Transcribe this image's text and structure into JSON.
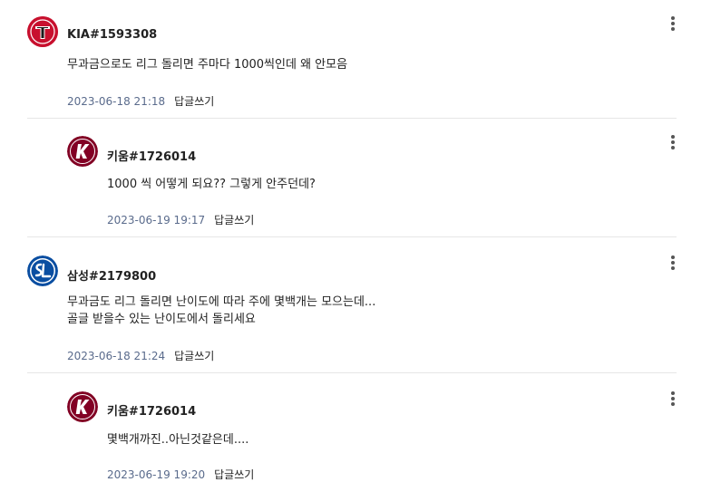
{
  "comments": [
    {
      "author": "KIA#1593308",
      "text": "무과금으로도 리그 돌리면 주마다 1000씩인데 왜 안모음",
      "date": "2023-06-18 21:18",
      "reply_label": "답글쓰기",
      "team": "KIA",
      "logo_glyph": "T",
      "logo_color": "#c8102e"
    },
    {
      "author": "키움#1726014",
      "text": "1000 씩 어떻게 되요?? 그렇게 안주던데?",
      "date": "2023-06-19 19:17",
      "reply_label": "답글쓰기",
      "team": "키움",
      "logo_glyph": "K",
      "logo_color": "#820024"
    },
    {
      "author": "삼성#2179800",
      "text": "무과금도 리그 돌리면 난이도에 따라 주에 몇백개는 모으는데...\n골글 받을수 있는 난이도에서 돌리세요",
      "date": "2023-06-18 21:24",
      "reply_label": "답글쓰기",
      "team": "삼성",
      "logo_glyph": "SL",
      "logo_color": "#0a4ea1"
    },
    {
      "author": "키움#1726014",
      "text": "몇백개까진..아닌것같은데....",
      "date": "2023-06-19 19:20",
      "reply_label": "답글쓰기",
      "team": "키움",
      "logo_glyph": "K",
      "logo_color": "#820024"
    }
  ]
}
